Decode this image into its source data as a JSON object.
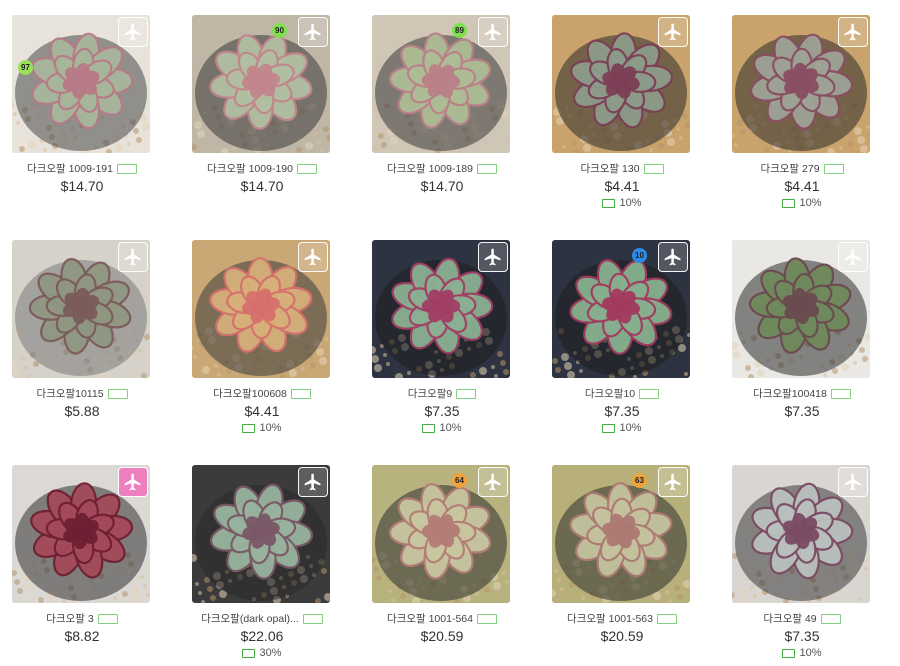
{
  "products": [
    {
      "name": "다크오팔 1009-191",
      "price": "$14.70",
      "discount": "",
      "tag": "97",
      "tagColor": "#9be05a",
      "bg": "#e7e2da",
      "pot": "#4a4a4a",
      "leaf": "#a7b79b",
      "tip": "#b87a86",
      "pink": false
    },
    {
      "name": "다크오팔 1009-190",
      "price": "$14.70",
      "discount": "",
      "tag": "90",
      "tagColor": "#7ee04f",
      "bg": "#bfb6a6",
      "pot": "#3a3a3a",
      "leaf": "#b2bfa2",
      "tip": "#c2868c",
      "pink": false
    },
    {
      "name": "다크오팔 1009-189",
      "price": "$14.70",
      "discount": "",
      "tag": "89",
      "tagColor": "#7ee04f",
      "bg": "#cfc6b5",
      "pot": "#3a3a3a",
      "leaf": "#aebd95",
      "tip": "#bb8088",
      "pink": false
    },
    {
      "name": "다크오팔 130",
      "price": "$4.41",
      "discount": "10%",
      "tag": "",
      "tagColor": "",
      "bg": "#c9a36b",
      "pot": "#2b2b2b",
      "leaf": "#8d9b8a",
      "tip": "#7d3f56",
      "pink": false
    },
    {
      "name": "다크오팔 279",
      "price": "$4.41",
      "discount": "10%",
      "tag": "",
      "tagColor": "",
      "bg": "#c9a36b",
      "pot": "#2b2b2b",
      "leaf": "#9ea396",
      "tip": "#8a4d62",
      "pink": false
    },
    {
      "name": "다크오팔10115",
      "price": "$5.88",
      "discount": "",
      "tag": "",
      "tagColor": "",
      "bg": "#d6d2c9",
      "pot": "#7a7a7a",
      "leaf": "#8f9781",
      "tip": "#7b5b5a",
      "pink": false
    },
    {
      "name": "다크오팔100608",
      "price": "$4.41",
      "discount": "10%",
      "tag": "",
      "tagColor": "",
      "bg": "#c9a875",
      "pot": "#3a3a3a",
      "leaf": "#d7b07a",
      "tip": "#d6706d",
      "pink": false
    },
    {
      "name": "다크오팔9",
      "price": "$7.35",
      "discount": "10%",
      "tag": "",
      "tagColor": "#2c8be8",
      "bg": "#2d3340",
      "pot": "#1d1d1d",
      "leaf": "#8bb093",
      "tip": "#a23e64",
      "pink": false
    },
    {
      "name": "다크오팔10",
      "price": "$7.35",
      "discount": "10%",
      "tag": "10",
      "tagColor": "#2c8be8",
      "bg": "#2d3340",
      "pot": "#1d1d1d",
      "leaf": "#86b08f",
      "tip": "#a23a5e",
      "pink": false
    },
    {
      "name": "다크오팔100418",
      "price": "$7.35",
      "discount": "",
      "tag": "",
      "tagColor": "",
      "bg": "#e9e8e4",
      "pot": "#2d2d2d",
      "leaf": "#6f8a5c",
      "tip": "#6b4a50",
      "pink": false
    },
    {
      "name": "다크오팔 3",
      "price": "$8.82",
      "discount": "",
      "tag": "",
      "tagColor": "",
      "bg": "#dcd8d4",
      "pot": "#333",
      "leaf": "#a44a5a",
      "tip": "#6f1f33",
      "pink": true
    },
    {
      "name": "다크오팔(dark opal)...",
      "price": "$22.06",
      "discount": "30%",
      "tag": "",
      "tagColor": "",
      "bg": "#3b3b3b",
      "pot": "#2a2a2a",
      "leaf": "#98b49e",
      "tip": "#7a5867",
      "pink": false
    },
    {
      "name": "다크오팔 1001-564",
      "price": "$20.59",
      "discount": "",
      "tag": "64",
      "tagColor": "#f0a23b",
      "bg": "#b8b27e",
      "pot": "#2f2f2f",
      "leaf": "#c9c7a0",
      "tip": "#b47c76",
      "pink": false
    },
    {
      "name": "다크오팔 1001-563",
      "price": "$20.59",
      "discount": "",
      "tag": "63",
      "tagColor": "#f0a23b",
      "bg": "#b7b07a",
      "pot": "#2f2f2f",
      "leaf": "#c4c39e",
      "tip": "#ad7973",
      "pink": false
    },
    {
      "name": "다크오팔 49",
      "price": "$7.35",
      "discount": "10%",
      "tag": "",
      "tagColor": "",
      "bg": "#d9d6d2",
      "pot": "#3d3d3d",
      "leaf": "#b9c0bd",
      "tip": "#7b4b63",
      "pink": false
    }
  ],
  "icons": {
    "overlay": "airplane-icon",
    "discount": "coupon-icon",
    "badge": "tag-badge"
  }
}
